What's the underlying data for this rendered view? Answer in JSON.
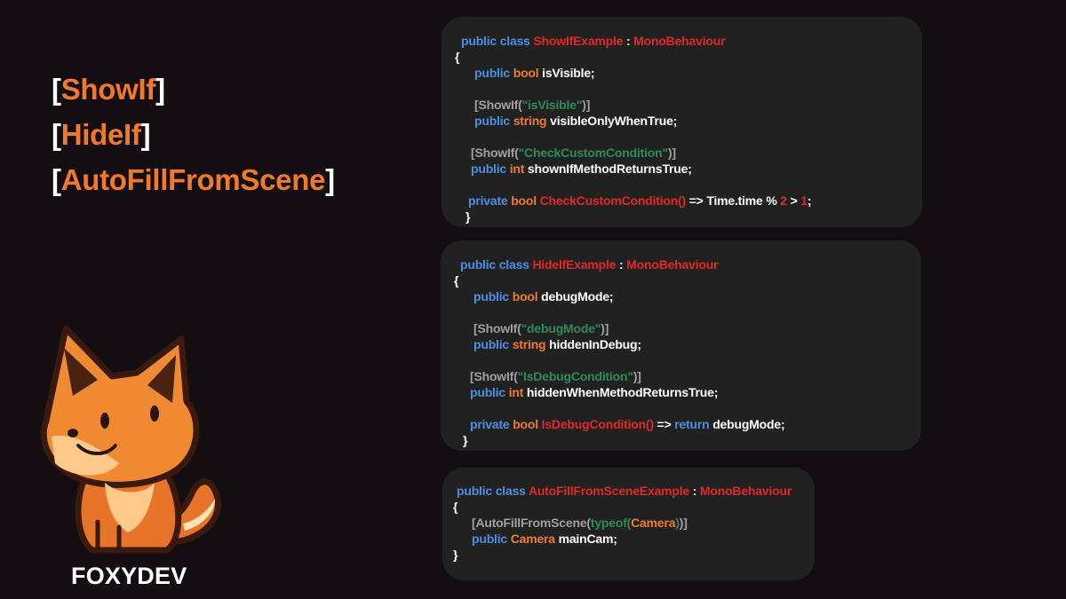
{
  "titles": [
    {
      "open": "[",
      "name": "ShowIf",
      "close": "]"
    },
    {
      "open": "[",
      "name": "HideIf",
      "close": "]"
    },
    {
      "open": "[",
      "name": "AutoFillFromScene",
      "close": "]"
    }
  ],
  "brand": {
    "name": "FOXYDEV"
  },
  "colors": {
    "background": "#140e13",
    "card": "#212121",
    "keyword": "#4a8fe0",
    "type": "#f07a2a",
    "class_name": "#e02828",
    "string": "#2e8b57",
    "attribute": "#a0a0a0",
    "text": "#ffffff"
  },
  "cards": [
    {
      "id": "showif",
      "lines": [
        [
          [
            "k",
            "public class "
          ],
          [
            "c",
            "ShowIfExample"
          ],
          [
            "w",
            " : "
          ],
          [
            "c",
            "MonoBehaviour"
          ]
        ],
        [
          [
            "w",
            "{"
          ]
        ],
        [
          [
            "k",
            "public "
          ],
          [
            "t",
            "bool "
          ],
          [
            "w",
            "isVisible;"
          ]
        ],
        [],
        [
          [
            "a",
            "[ShowIf("
          ],
          [
            "s",
            "\"isVisible\""
          ],
          [
            "a",
            ")]"
          ]
        ],
        [
          [
            "k",
            "public "
          ],
          [
            "t",
            "string "
          ],
          [
            "w",
            "visibleOnlyWhenTrue;"
          ]
        ],
        [],
        [
          [
            "a",
            "[ShowIf("
          ],
          [
            "s",
            "\"CheckCustomCondition\""
          ],
          [
            "a",
            ")]"
          ]
        ],
        [
          [
            "k",
            "public "
          ],
          [
            "t",
            "int "
          ],
          [
            "w",
            "shownIfMethodReturnsTrue;"
          ]
        ],
        [],
        [
          [
            "k",
            "private "
          ],
          [
            "t",
            "bool "
          ],
          [
            "c",
            "CheckCustomCondition()"
          ],
          [
            "w",
            " => Time.time % "
          ],
          [
            "c",
            "2"
          ],
          [
            "w",
            " > "
          ],
          [
            "c",
            "1"
          ],
          [
            "w",
            ";"
          ]
        ],
        [
          [
            "w",
            "}"
          ]
        ]
      ]
    },
    {
      "id": "hideif",
      "lines": [
        [
          [
            "k",
            "public class "
          ],
          [
            "c",
            "HideIfExample"
          ],
          [
            "w",
            " : "
          ],
          [
            "c",
            "MonoBehaviour"
          ]
        ],
        [
          [
            "w",
            "{"
          ]
        ],
        [
          [
            "k",
            "public "
          ],
          [
            "t",
            "bool "
          ],
          [
            "w",
            "debugMode;"
          ]
        ],
        [],
        [
          [
            "a",
            "[ShowIf("
          ],
          [
            "s",
            "\"debugMode\""
          ],
          [
            "a",
            ")]"
          ]
        ],
        [
          [
            "k",
            "public "
          ],
          [
            "t",
            "string "
          ],
          [
            "w",
            "hiddenInDebug;"
          ]
        ],
        [],
        [
          [
            "a",
            "[ShowIf("
          ],
          [
            "s",
            "\"IsDebugCondition\""
          ],
          [
            "a",
            ")]"
          ]
        ],
        [
          [
            "k",
            "public "
          ],
          [
            "t",
            "int "
          ],
          [
            "w",
            "hiddenWhenMethodReturnsTrue;"
          ]
        ],
        [],
        [
          [
            "k",
            "private "
          ],
          [
            "t",
            "bool "
          ],
          [
            "c",
            "IsDebugCondition()"
          ],
          [
            "w",
            " => "
          ],
          [
            "k",
            "return "
          ],
          [
            "w",
            "debugMode;"
          ]
        ],
        [
          [
            "w",
            "}"
          ]
        ]
      ]
    },
    {
      "id": "autofill",
      "lines": [
        [
          [
            "k",
            "public class "
          ],
          [
            "c",
            "AutoFillFromSceneExample"
          ],
          [
            "w",
            " : "
          ],
          [
            "c",
            "MonoBehaviour"
          ]
        ],
        [
          [
            "w",
            "{"
          ]
        ],
        [
          [
            "a",
            "[AutoFillFromScene("
          ],
          [
            "s",
            "typeof("
          ],
          [
            "t",
            "Camera"
          ],
          [
            "s",
            ")"
          ],
          [
            "a",
            ")]"
          ]
        ],
        [
          [
            "k",
            "public "
          ],
          [
            "t",
            "Camera "
          ],
          [
            "w",
            "mainCam;"
          ]
        ],
        [
          [
            "w",
            "}"
          ]
        ]
      ]
    }
  ]
}
